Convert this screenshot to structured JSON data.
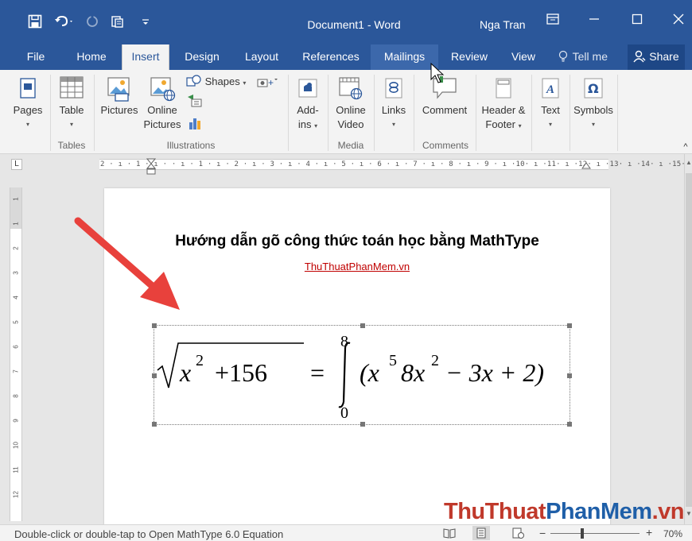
{
  "window": {
    "title": "Document1  -  Word",
    "user": "Nga Tran",
    "quick_access": [
      "save-icon",
      "undo-icon",
      "redo-icon",
      "touch-mode-icon",
      "customize-icon"
    ],
    "controls": [
      "ribbon-display-icon",
      "minimize-icon",
      "maximize-icon",
      "close-icon"
    ]
  },
  "tabs": [
    {
      "label": "File"
    },
    {
      "label": "Home"
    },
    {
      "label": "Insert",
      "active": true
    },
    {
      "label": "Design"
    },
    {
      "label": "Layout"
    },
    {
      "label": "References"
    },
    {
      "label": "Mailings",
      "hover": true
    },
    {
      "label": "Review"
    },
    {
      "label": "View"
    }
  ],
  "tell_me": "Tell me",
  "share": "Share",
  "ribbon": {
    "pages": "Pages",
    "table": "Table",
    "tables_group": "Tables",
    "pictures": "Pictures",
    "online_pictures_1": "Online",
    "online_pictures_2": "Pictures",
    "shapes": "Shapes",
    "illustrations_group": "Illustrations",
    "addins_1": "Add-",
    "addins_2": "ins",
    "online_video_1": "Online",
    "online_video_2": "Video",
    "media_group": "Media",
    "links": "Links",
    "comment": "Comment",
    "comments_group": "Comments",
    "header_footer_1": "Header &",
    "header_footer_2": "Footer",
    "text": "Text",
    "symbols": "Symbols"
  },
  "ruler": {
    "corner": "L",
    "marks": "2 · ı · 1 · ı ·  ·  ı · 1 · ı · 2 · ı · 3 · ı · 4 · ı · 5 · ı · 6 · ı · 7 · ı · 8 · ı · 9 · ı ·10· ı ·11· ı ·12· ı ·13· ı ·14· ı ·15· ı ·16· ı ·17· ı ·18· ı ·",
    "vertical": [
      "1",
      "1",
      "2",
      "3",
      "4",
      "5",
      "6",
      "7",
      "8",
      "9",
      "10",
      "11",
      "12"
    ]
  },
  "document": {
    "heading": "Hướng dẫn gõ công thức toán học bằng MathType",
    "link": "ThuThuatPhanMem.vn",
    "equation": {
      "sqrt_arg": "x",
      "sqrt_exp": "2",
      "sqrt_rest": "+156",
      "equals": "=",
      "upper": "8",
      "lower": "0",
      "body_1": "(x",
      "exp_1": "5",
      "body_2": "8x",
      "exp_2": "2",
      "body_3": "− 3x + 2)"
    }
  },
  "status": {
    "text": "Double-click or double-tap to Open MathType 6.0 Equation",
    "zoom": "70%"
  },
  "watermark": {
    "part1": "ThuThuat",
    "part2": "PhanMem",
    "part3": ".vn"
  },
  "colors": {
    "accent": "#2b579a",
    "arrow": "#e8413c",
    "link": "#c00000"
  }
}
